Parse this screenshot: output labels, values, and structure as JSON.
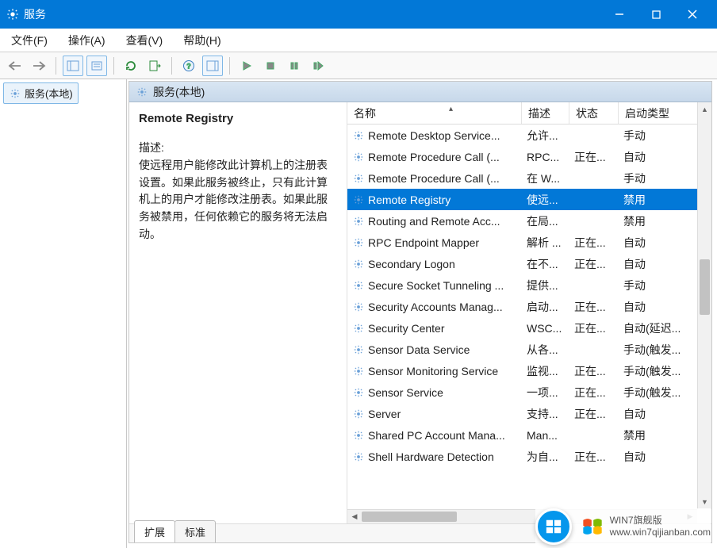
{
  "window": {
    "title": "服务"
  },
  "menu": {
    "file": "文件(F)",
    "action": "操作(A)",
    "view": "查看(V)",
    "help": "帮助(H)"
  },
  "leftnav": {
    "label": "服务(本地)"
  },
  "pane": {
    "header": "服务(本地)"
  },
  "detail": {
    "name": "Remote Registry",
    "desc_label": "描述:",
    "desc_text": "使远程用户能修改此计算机上的注册表设置。如果此服务被终止，只有此计算机上的用户才能修改注册表。如果此服务被禁用，任何依赖它的服务将无法启动。"
  },
  "columns": {
    "name": "名称",
    "desc": "描述",
    "status": "状态",
    "startup": "启动类型"
  },
  "rows": [
    {
      "name": "Remote Desktop Service...",
      "desc": "允许...",
      "status": "",
      "startup": "手动"
    },
    {
      "name": "Remote Procedure Call (...",
      "desc": "RPC...",
      "status": "正在...",
      "startup": "自动"
    },
    {
      "name": "Remote Procedure Call (...",
      "desc": "在 W...",
      "status": "",
      "startup": "手动"
    },
    {
      "name": "Remote Registry",
      "desc": "使远...",
      "status": "",
      "startup": "禁用",
      "selected": true
    },
    {
      "name": "Routing and Remote Acc...",
      "desc": "在局...",
      "status": "",
      "startup": "禁用"
    },
    {
      "name": "RPC Endpoint Mapper",
      "desc": "解析 ...",
      "status": "正在...",
      "startup": "自动"
    },
    {
      "name": "Secondary Logon",
      "desc": "在不...",
      "status": "正在...",
      "startup": "自动"
    },
    {
      "name": "Secure Socket Tunneling ...",
      "desc": "提供...",
      "status": "",
      "startup": "手动"
    },
    {
      "name": "Security Accounts Manag...",
      "desc": "启动...",
      "status": "正在...",
      "startup": "自动"
    },
    {
      "name": "Security Center",
      "desc": "WSC...",
      "status": "正在...",
      "startup": "自动(延迟..."
    },
    {
      "name": "Sensor Data Service",
      "desc": "从各...",
      "status": "",
      "startup": "手动(触发..."
    },
    {
      "name": "Sensor Monitoring Service",
      "desc": "监视...",
      "status": "正在...",
      "startup": "手动(触发..."
    },
    {
      "name": "Sensor Service",
      "desc": "一项...",
      "status": "正在...",
      "startup": "手动(触发..."
    },
    {
      "name": "Server",
      "desc": "支持...",
      "status": "正在...",
      "startup": "自动"
    },
    {
      "name": "Shared PC Account Mana...",
      "desc": "Man...",
      "status": "",
      "startup": "禁用"
    },
    {
      "name": "Shell Hardware Detection",
      "desc": "为自...",
      "status": "正在...",
      "startup": "自动"
    }
  ],
  "tabs": {
    "extended": "扩展",
    "standard": "标准"
  },
  "watermark": {
    "line1": "WIN7旗舰版",
    "line2": "www.win7qijianban.com"
  }
}
